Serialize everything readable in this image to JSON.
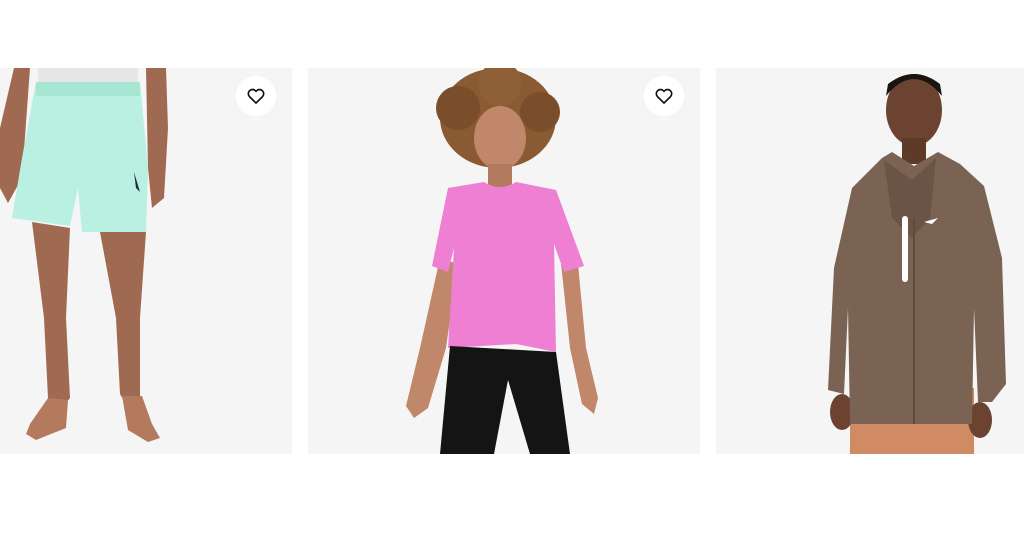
{
  "products": [
    {
      "name": "mint-shorts",
      "has_favorite": true,
      "favorite_icon": "heart-outline-icon"
    },
    {
      "name": "pink-crop-tee",
      "has_favorite": true,
      "favorite_icon": "heart-outline-icon"
    },
    {
      "name": "brown-hooded-jacket",
      "has_favorite": false
    }
  ],
  "colors": {
    "card_bg": "#f5f5f5",
    "shorts": "#b9f0e1",
    "tee": "#ee7fd2",
    "jacket": "#7a6352",
    "skin_light": "#c0876a",
    "skin_dark": "#6b4330",
    "leggings": "#141414",
    "pants": "#d08a64"
  }
}
